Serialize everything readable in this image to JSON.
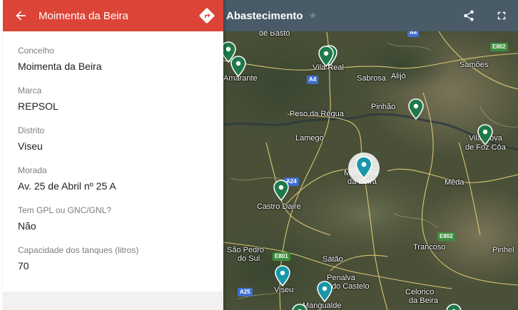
{
  "panel": {
    "title": "Moimenta da Beira",
    "fields": [
      {
        "label": "Concelho",
        "value": "Moimenta da Beira"
      },
      {
        "label": "Marca",
        "value": "REPSOL"
      },
      {
        "label": "Distrito",
        "value": "Viseu"
      },
      {
        "label": "Morada",
        "value": "Av. 25 de Abril nº 25 A"
      },
      {
        "label": "Tem GPL ou GNC/GNL?",
        "value": "Não"
      },
      {
        "label": "Capacidade dos tanques (litros)",
        "value": "70"
      }
    ]
  },
  "map": {
    "title": "Abastecimento",
    "places": {
      "basto": "de Basto",
      "amarante": "Amarante",
      "vila_real": "Vila Real",
      "sabrosa": "Sabrosa",
      "alijo": "Alijó",
      "samoes": "Samões",
      "peso": "Peso da Régua",
      "pinhao": "Pinhão",
      "vilanova1": "Vila Nova",
      "vilanova2": "de Foz Côa",
      "lamego": "Lamego",
      "moimenta1": "Moimenta",
      "moimenta2": "da Beira",
      "castro": "Castro Daire",
      "meda": "Mêda",
      "trancoso": "Trancoso",
      "pinhel": "Pinhel",
      "saopedro1": "São Pedro",
      "saopedro2": "do Sul",
      "satao": "Sátão",
      "penalva1": "Penalva",
      "penalva2": "do Castelo",
      "viseu": "Viseu",
      "mangualde": "Mangualde",
      "celorico1": "Celorico",
      "celorico2": "da Beira"
    },
    "roads": {
      "a4": "A4",
      "a24": "A24",
      "a25": "A25",
      "e802a": "E802",
      "e802b": "E802",
      "e801": "E801"
    }
  }
}
